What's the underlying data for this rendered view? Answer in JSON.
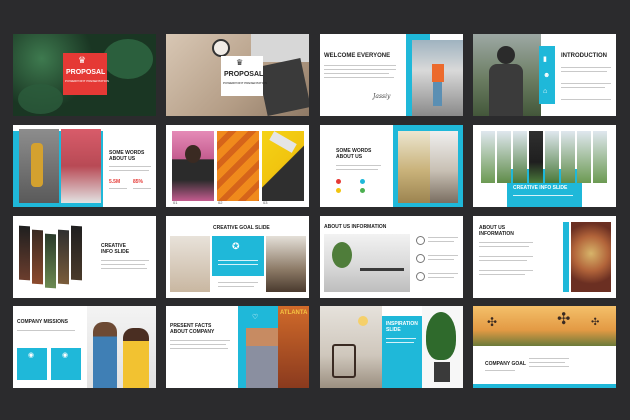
{
  "colors": {
    "background": "#2b2b2d",
    "accent": "#1fb8d9",
    "red": "#e53935"
  },
  "slides": {
    "s1": {
      "title": "PROPOSAL",
      "subtitle": "POWERPOINT PRESENTATION",
      "icon": "crown-icon"
    },
    "s2": {
      "title": "PROPOSAL",
      "subtitle": "POWERPOINT PRESENTATION",
      "icon": "crown-icon"
    },
    "s3": {
      "title": "WELCOME EVERYONE",
      "signature": "Jassiy"
    },
    "s4": {
      "title": "INTRODUCTION"
    },
    "s5": {
      "title_1": "SOME WORDS",
      "title_2": "ABOUT US",
      "stat_1": "5.5M",
      "stat_2": "85%"
    },
    "s6": {},
    "s7": {
      "title_1": "SOME WORDS",
      "title_2": "ABOUT US"
    },
    "s8": {
      "title": "CREATIVE INFO SLIDE"
    },
    "s9": {
      "title_1": "CREATIVE",
      "title_2": "INFO SLIDE"
    },
    "s10": {
      "title": "CREATIVE GOAL SLIDE"
    },
    "s11": {
      "title": "ABOUT US INFORMATION"
    },
    "s12": {
      "title_1": "ABOUT US",
      "title_2": "INFORMATION"
    },
    "s13": {
      "title": "COMPANY MISSIONS"
    },
    "s14": {
      "title_1": "PRESENT FACTS",
      "title_2": "ABOUT COMPANY",
      "poster": "ATLANTA"
    },
    "s15": {
      "title_1": "INSPIRATION",
      "title_2": "SLIDE"
    },
    "s16": {
      "title": "COMPANY GOAL"
    }
  }
}
